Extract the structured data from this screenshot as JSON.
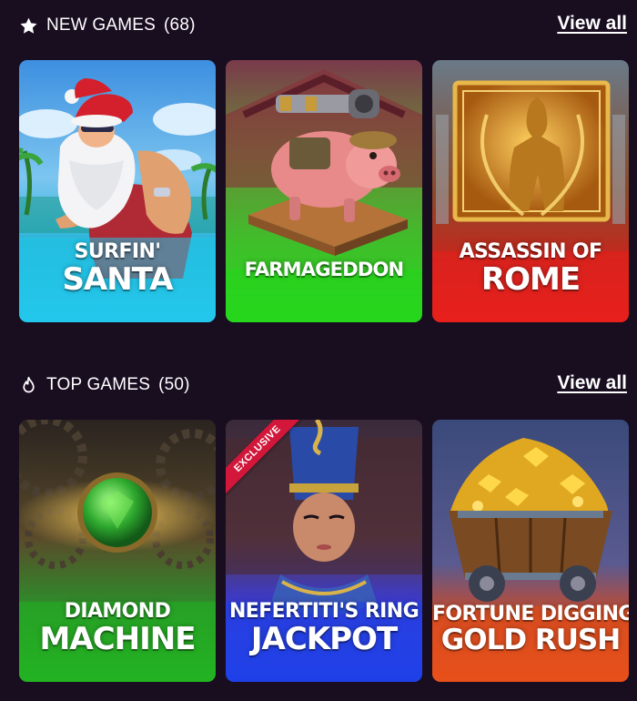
{
  "sections": {
    "new": {
      "title": "NEW GAMES",
      "count": "(68)",
      "icon": "star-icon",
      "view_all": "View all",
      "games": [
        {
          "line1": "SURFIN'",
          "line2": "SANTA",
          "accent": "#1ec0e8"
        },
        {
          "line1": "FARMAGEDDON",
          "line2": "",
          "accent": "#2ed52f"
        },
        {
          "line1": "ASSASSIN OF",
          "line2": "ROME",
          "accent": "#e8201d"
        }
      ]
    },
    "top": {
      "title": "TOP GAMES",
      "count": "(50)",
      "icon": "fire-icon",
      "view_all": "View all",
      "games": [
        {
          "line1": "DIAMOND",
          "line2": "MACHINE",
          "accent": "#29b229"
        },
        {
          "line1": "NEFERTITI'S RING",
          "line2": "JACKPOT",
          "accent": "#2543e0",
          "badge": "EXCLUSIVE"
        },
        {
          "line1": "FORTUNE DIGGING",
          "line2": "GOLD RUSH",
          "accent": "#e8501a"
        }
      ]
    }
  }
}
